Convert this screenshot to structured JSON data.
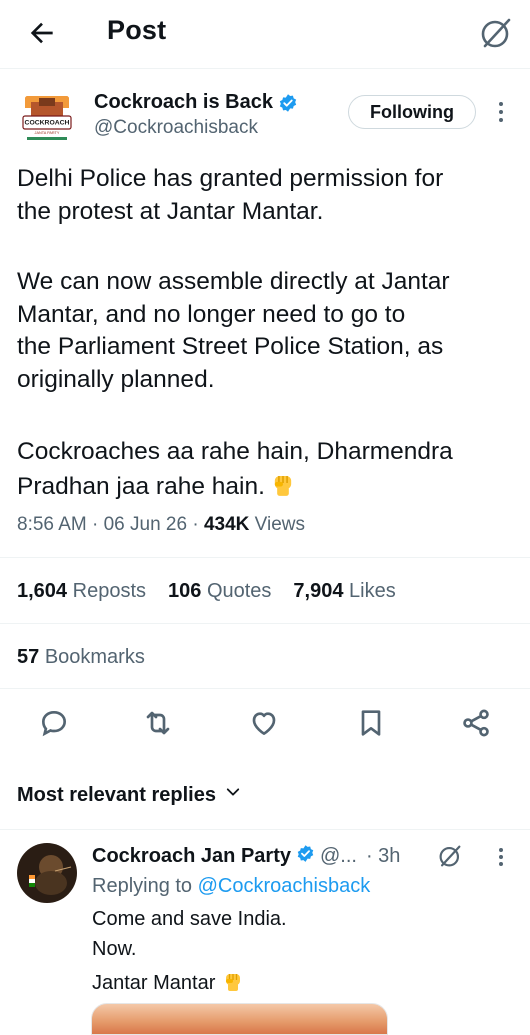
{
  "header": {
    "title": "Post"
  },
  "post": {
    "author_name": "Cockroach is Back",
    "author_handle": "@Cockroachisback",
    "avatar_text_top": "COCKROACH",
    "avatar_text_bottom": "JANTA PARTY",
    "follow_label": "Following",
    "paragraphs": [
      "Delhi Police has granted permission for\nthe protest at Jantar Mantar.",
      "We can now assemble directly at Jantar\nMantar, and no longer need to go to\nthe Parliament Street Police Station, as\noriginally planned.",
      "Cockroaches aa rahe hain, Dharmendra\nPradhan jaa rahe hain."
    ],
    "time": "8:56 AM",
    "date": "06 Jun 26",
    "views_count": "434K",
    "views_label": "Views",
    "reposts_count": "1,604",
    "reposts_label": "Reposts",
    "quotes_count": "106",
    "quotes_label": "Quotes",
    "likes_count": "7,904",
    "likes_label": "Likes",
    "bookmarks_count": "57",
    "bookmarks_label": "Bookmarks"
  },
  "replies_sort_label": "Most relevant replies",
  "reply": {
    "author_name": "Cockroach Jan Party",
    "author_handle": "@...",
    "time_ago": "· 3h",
    "replying_prefix": "Replying to",
    "replying_to": "@Cockroachisback",
    "lines": [
      "Come and save India.",
      "Now.",
      "Jantar Mantar"
    ]
  },
  "icons": {
    "back": "arrow-left-icon",
    "grok": "grok-icon",
    "verified": "verified-badge-icon",
    "more": "more-vertical-icon",
    "reply": "reply-icon",
    "repost": "repost-icon",
    "like": "heart-icon",
    "bookmark": "bookmark-icon",
    "share": "share-icon",
    "dropdown": "chevron-down-icon",
    "fist": "raised-fist-emoji-icon"
  },
  "colors": {
    "accent": "#1d9bf0",
    "text": "#0f1419",
    "secondary": "#536471",
    "border": "#eff3f4"
  }
}
